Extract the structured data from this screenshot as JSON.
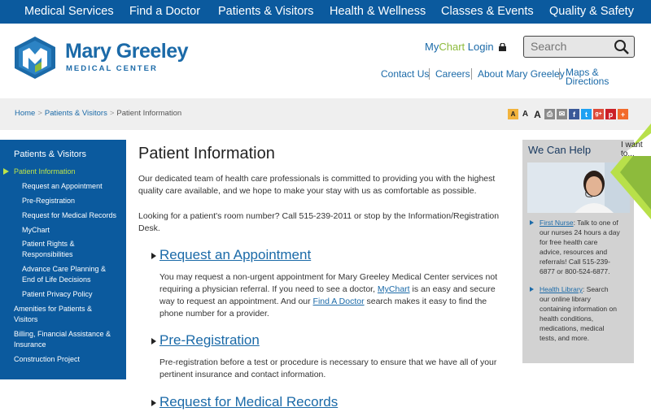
{
  "topnav": {
    "items": [
      "Medical Services",
      "Find a Doctor",
      "Patients & Visitors",
      "Health & Wellness",
      "Classes & Events",
      "Quality & Safety"
    ]
  },
  "brand": {
    "name": "Mary Greeley",
    "sub": "MEDICAL CENTER",
    "colors": {
      "blue": "#0b5a9e",
      "green": "#8dbb3c"
    }
  },
  "mychart": {
    "my": "My",
    "chart": "Chart",
    "login": " Login"
  },
  "search": {
    "placeholder": "Search"
  },
  "util_links": [
    "Contact Us",
    "Careers",
    "About Mary Greeley",
    "Maps &",
    "Directions"
  ],
  "breadcrumb": {
    "home": "Home",
    "patients": "Patients & Visitors",
    "current": "Patient Information"
  },
  "tools": [
    "A",
    "A",
    "A"
  ],
  "sidebar": {
    "title": "Patients & Visitors",
    "items": [
      "Patient Information",
      "Request an Appointment",
      "Pre-Registration",
      "Request for Medical Records",
      "MyChart",
      "Patient Rights &",
      "Responsibilities",
      "Advance Care Planning &",
      "End of Life Decisions",
      "Patient Privacy Policy",
      "Amenities for Patients &",
      "Visitors",
      "Billing, Financial Assistance &",
      "Insurance",
      "Construction Project"
    ]
  },
  "main": {
    "title": "Patient Information",
    "intro1": "Our dedicated team of health care professionals is committed to providing you with the highest",
    "intro2": "quality care available, and we hope to make your stay with us as comfortable as possible.",
    "room1": "Looking for a patient's room number? Call 515-239-2011 or stop by the Information/Registration",
    "room2": "Desk.",
    "sec1_title": "Request an Appointment",
    "sec1_l1": "You may request a non-urgent appointment for Mary Greeley Medical Center services not",
    "sec1_l2a": "requiring a physician referral. If you need to see a doctor, ",
    "sec1_l2link": "MyChart",
    "sec1_l2b": " is an easy and secure",
    "sec1_l3a": "way to request an appointment. And our ",
    "sec1_l3link": "Find A Doctor",
    "sec1_l3b": " search makes it easy to find the",
    "sec1_l4": "phone number for a provider.",
    "sec2_title": "Pre-Registration",
    "sec2_l1": "Pre-registration before a test or procedure is necessary to ensure that we have all of your",
    "sec2_l2": "pertinent insurance and contact information.",
    "sec3_title": "Request for Medical Records"
  },
  "help": {
    "title": "We Can Help",
    "nurse_link": "First Nurse",
    "nurse_lines": [
      ": Talk to one of",
      "our nurses 24 hours a day",
      "for free health care",
      "advice, resources and",
      "referrals! Call 515-239-",
      "6877 or 800-524-6877."
    ],
    "library_link": "Health Library",
    "library_lines": [
      ": Search",
      "our online library",
      "containing information on",
      "health conditions,",
      "medications, medical",
      "tests, and more."
    ]
  },
  "want": {
    "l1": "I want",
    "l2": "to..."
  }
}
